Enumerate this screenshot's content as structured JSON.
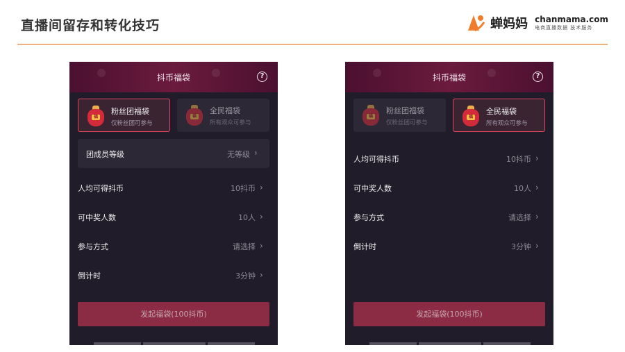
{
  "slide": {
    "title": "直播间留存和转化技巧",
    "logo_cn": "蝉妈妈",
    "logo_url": "chanmama.com",
    "logo_tagline": "电商直播数据 技术服务"
  },
  "phone_left": {
    "title": "抖币福袋",
    "help_glyph": "?",
    "tabs": [
      {
        "label": "粉丝团福袋",
        "sub": "仅粉丝团可参与",
        "selected": true
      },
      {
        "label": "全民福袋",
        "sub": "所有观众可参与",
        "selected": false
      }
    ],
    "level_row": {
      "label": "团成员等级",
      "value": "无等级"
    },
    "rows": [
      {
        "label": "人均可得抖币",
        "value": "10抖币"
      },
      {
        "label": "可中奖人数",
        "value": "10人"
      },
      {
        "label": "参与方式",
        "value": "请选择"
      },
      {
        "label": "倒计时",
        "value": "3分钟"
      }
    ],
    "button": "发起福袋(100抖币)"
  },
  "phone_right": {
    "title": "抖币福袋",
    "help_glyph": "?",
    "tabs": [
      {
        "label": "粉丝团福袋",
        "sub": "仅粉丝团可参与",
        "selected": false
      },
      {
        "label": "全民福袋",
        "sub": "所有观众可参与",
        "selected": true
      }
    ],
    "rows": [
      {
        "label": "人均可得抖币",
        "value": "10抖币"
      },
      {
        "label": "可中奖人数",
        "value": "10人"
      },
      {
        "label": "参与方式",
        "value": "请选择"
      },
      {
        "label": "倒计时",
        "value": "3分钟"
      }
    ],
    "button": "发起福袋(100抖币)"
  },
  "icons": {
    "chevron": "chevron-right-icon",
    "help": "question-circle-icon",
    "bag": "lucky-bag-icon",
    "bag_glyph": "福"
  },
  "colors": {
    "accent": "#e2465e",
    "button": "#8c2b44",
    "brand_orange": "#f07d2b",
    "divider": "#f0b27d"
  }
}
